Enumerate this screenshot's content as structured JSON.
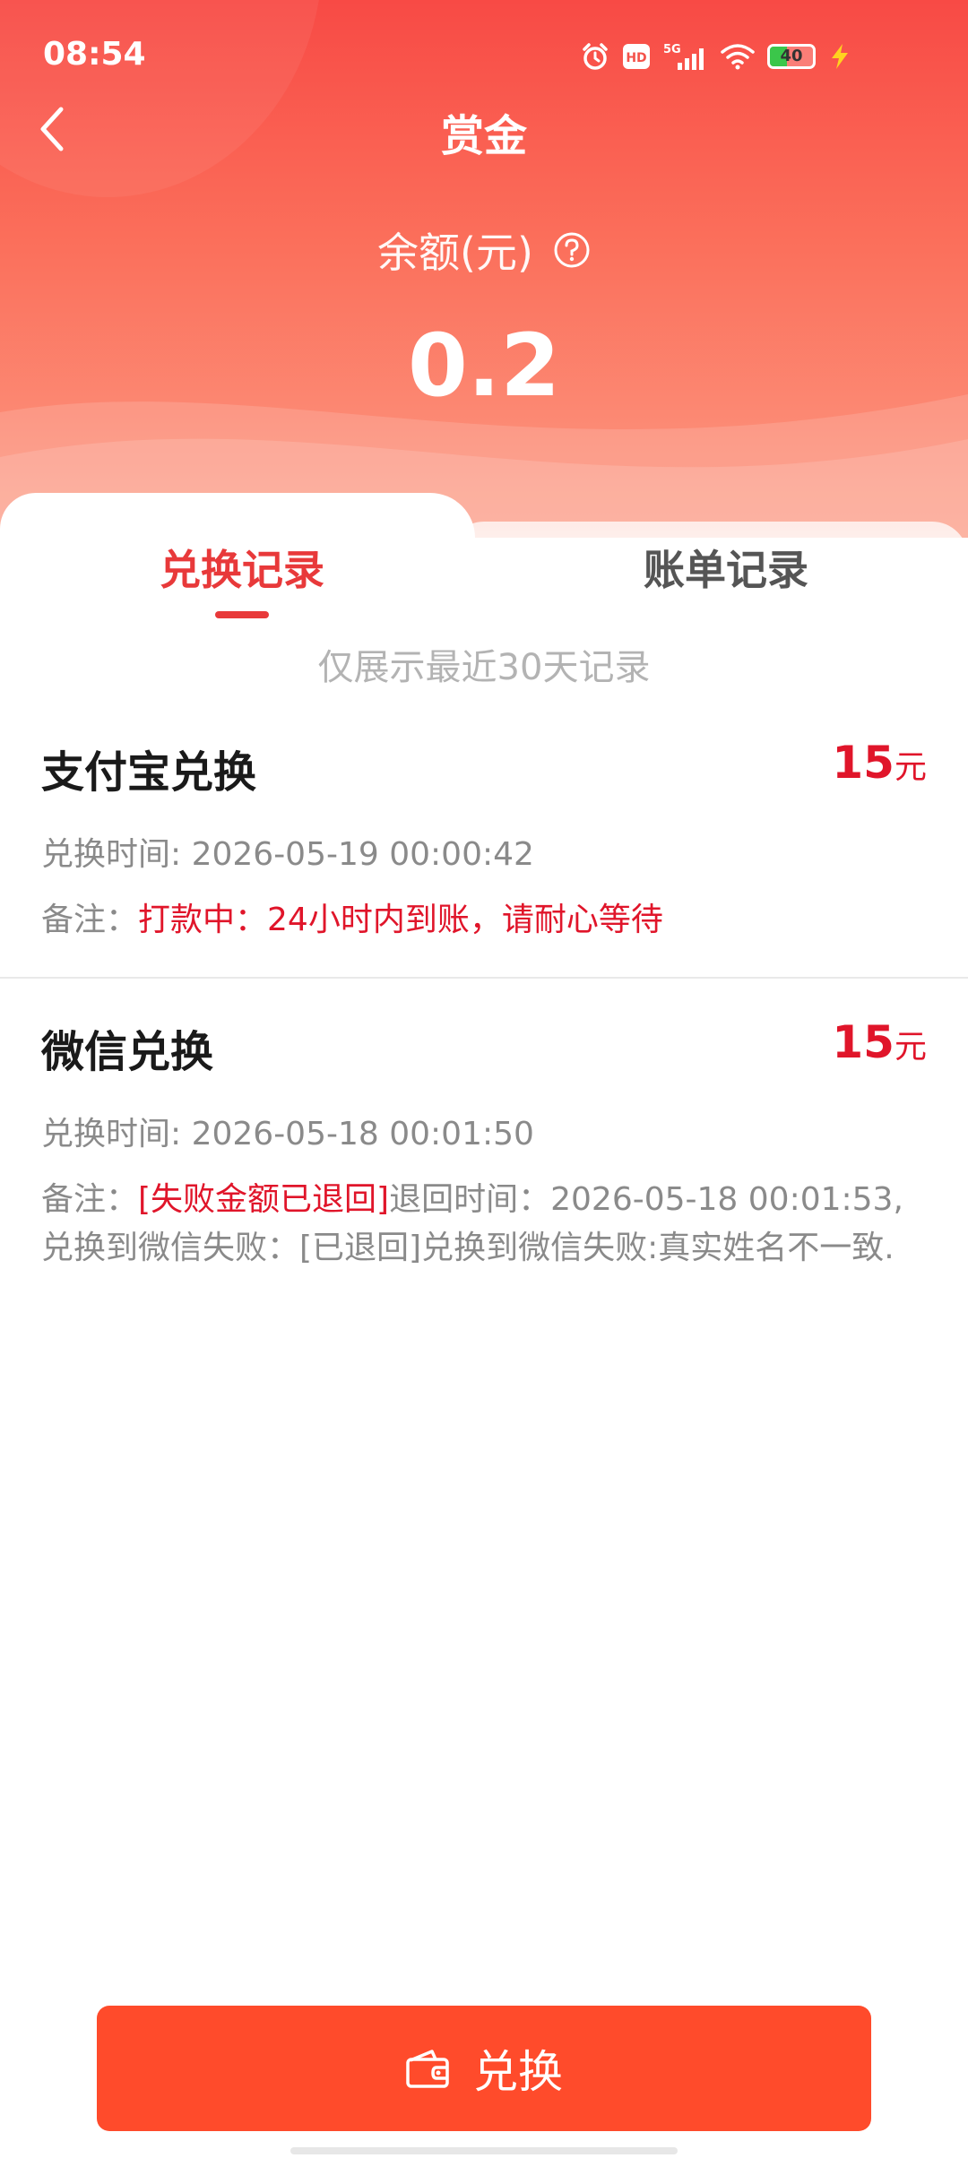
{
  "status_bar": {
    "time": "08:54",
    "network": "5G",
    "battery": "40",
    "battery_level": 0.4,
    "icons": [
      "alarm-icon",
      "hd-icon",
      "signal-5g-icon",
      "wifi-icon",
      "battery-icon",
      "charging-icon"
    ]
  },
  "header": {
    "title": "赏金",
    "back_icon": "chevron-left-icon",
    "balance_label": "余额(元)",
    "help_icon": "question-circle-icon",
    "balance_value": "0.2"
  },
  "tabs": [
    {
      "label": "兑换记录",
      "active": true
    },
    {
      "label": "账单记录",
      "active": false
    }
  ],
  "notice": "仅展示最近30天记录",
  "records": [
    {
      "title": "支付宝兑换",
      "amount": "15",
      "unit": "元",
      "time": "兑换时间: 2026-05-19 00:00:42",
      "note_label": "备注：",
      "note_highlight": "打款中：24小时内到账，请耐心等待",
      "note_rest": ""
    },
    {
      "title": "微信兑换",
      "amount": "15",
      "unit": "元",
      "time": "兑换时间: 2026-05-18 00:01:50",
      "note_label": "备注：",
      "note_highlight": "[失败金额已退回]",
      "note_rest": "退回时间：2026-05-18 00:01:53,兑换到微信失败：[已退回]兑换到微信失败:真实姓名不一致."
    }
  ],
  "exchange_button": {
    "label": "兑换",
    "icon": "wallet-icon"
  },
  "colors": {
    "brand_red": "#f84a45",
    "active_tab": "#e8393a",
    "amount_red": "#e0152a",
    "button": "#ff4b2b"
  }
}
